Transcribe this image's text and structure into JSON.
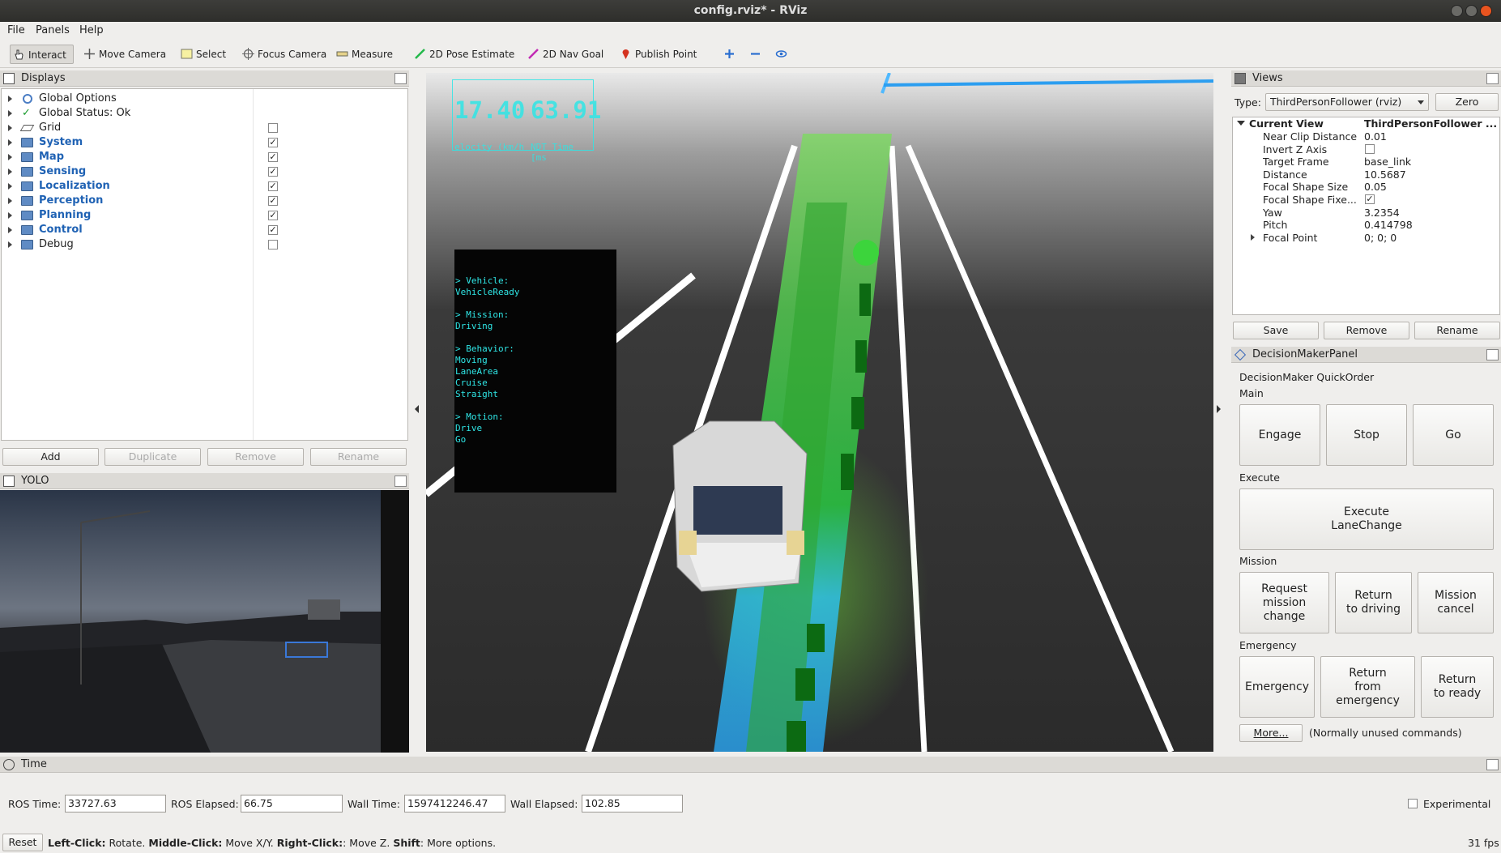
{
  "window": {
    "title": "config.rviz* - RViz"
  },
  "menu": [
    "File",
    "Panels",
    "Help"
  ],
  "toolbar": {
    "interact": "Interact",
    "move_camera": "Move Camera",
    "select": "Select",
    "focus_camera": "Focus Camera",
    "measure": "Measure",
    "pose_estimate": "2D Pose Estimate",
    "nav_goal": "2D Nav Goal",
    "publish_point": "Publish Point"
  },
  "displays": {
    "title": "Displays",
    "items": [
      {
        "label": "Global Options",
        "checked": null,
        "bold": false
      },
      {
        "label": "Global Status: Ok",
        "checked": null,
        "bold": false
      },
      {
        "label": "Grid",
        "checked": false,
        "bold": false
      },
      {
        "label": "System",
        "checked": true,
        "bold": true
      },
      {
        "label": "Map",
        "checked": true,
        "bold": true
      },
      {
        "label": "Sensing",
        "checked": true,
        "bold": true
      },
      {
        "label": "Localization",
        "checked": true,
        "bold": true
      },
      {
        "label": "Perception",
        "checked": true,
        "bold": true
      },
      {
        "label": "Planning",
        "checked": true,
        "bold": true
      },
      {
        "label": "Control",
        "checked": true,
        "bold": true
      },
      {
        "label": "Debug",
        "checked": false,
        "bold": false
      }
    ],
    "buttons": {
      "add": "Add",
      "duplicate": "Duplicate",
      "remove": "Remove",
      "rename": "Rename"
    }
  },
  "yolo": {
    "title": "YOLO"
  },
  "viewport": {
    "velocity_value": "17.40",
    "velocity_label": "elocity (km/h",
    "ndt_value": "63.91",
    "ndt_label": "NDT Time [ms",
    "status_lines": [
      "> Vehicle:",
      "VehicleReady",
      "",
      "> Mission:",
      "Driving",
      "",
      "> Behavior:",
      "Moving",
      "LaneArea",
      "Cruise",
      "Straight",
      "",
      "> Motion:",
      "Drive",
      "Go"
    ]
  },
  "views": {
    "title": "Views",
    "type_label": "Type:",
    "type_value": "ThirdPersonFollower (rviz)",
    "zero": "Zero",
    "current_view": "Current View",
    "current_view_value": "ThirdPersonFollower ...",
    "props": [
      {
        "name": "Near Clip Distance",
        "value": "0.01"
      },
      {
        "name": "Invert Z Axis",
        "value": "",
        "checkbox": false
      },
      {
        "name": "Target Frame",
        "value": "base_link"
      },
      {
        "name": "Distance",
        "value": "10.5687"
      },
      {
        "name": "Focal Shape Size",
        "value": "0.05"
      },
      {
        "name": "Focal Shape Fixe...",
        "value": "",
        "checkbox": true
      },
      {
        "name": "Yaw",
        "value": "3.2354"
      },
      {
        "name": "Pitch",
        "value": "0.414798"
      },
      {
        "name": "Focal Point",
        "value": "0; 0; 0"
      }
    ],
    "save": "Save",
    "remove": "Remove",
    "rename": "Rename"
  },
  "decision": {
    "title": "DecisionMakerPanel",
    "quickorder": "DecisionMaker QuickOrder",
    "main": "Main",
    "engage": "Engage",
    "stop": "Stop",
    "go": "Go",
    "execute": "Execute",
    "execute_lane": "Execute\nLaneChange",
    "mission": "Mission",
    "request": "Request\nmission change",
    "return_driving": "Return\nto driving",
    "mission_cancel": "Mission\ncancel",
    "emergency_label": "Emergency",
    "emergency": "Emergency",
    "return_emergency": "Return\nfrom emergency",
    "return_ready": "Return\nto ready",
    "more": "More...",
    "unused": "(Normally unused commands)"
  },
  "time": {
    "title": "Time",
    "ros_time_label": "ROS Time:",
    "ros_time": "33727.63",
    "ros_elapsed_label": "ROS Elapsed:",
    "ros_elapsed": "66.75",
    "wall_time_label": "Wall Time:",
    "wall_time": "1597412246.47",
    "wall_elapsed_label": "Wall Elapsed:",
    "wall_elapsed": "102.85",
    "experimental": "Experimental"
  },
  "status": {
    "reset": "Reset",
    "left": "Left-Click:",
    "left_t": " Rotate. ",
    "middle": "Middle-Click:",
    "middle_t": " Move X/Y. ",
    "right": "Right-Click:",
    "right_t": ": Move Z. ",
    "shift": "Shift",
    "shift_t": ": More options.",
    "fps": "31 fps"
  }
}
